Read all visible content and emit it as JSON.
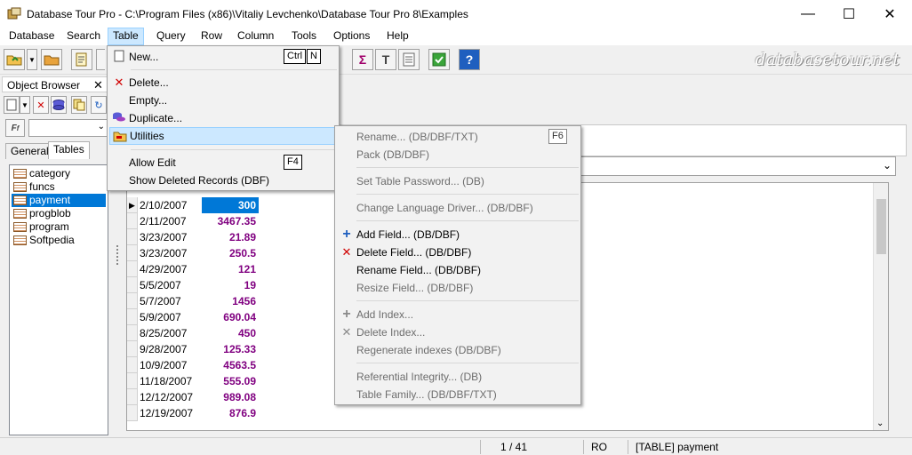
{
  "window": {
    "title": "Database Tour Pro - C:\\Program Files (x86)\\Vitaliy Levchenko\\Database Tour Pro 8\\Examples",
    "minimize_glyph": "—",
    "maximize_glyph": "☐",
    "close_glyph": "✕"
  },
  "menubar": [
    "Database",
    "Search",
    "Table",
    "Query",
    "Row",
    "Column",
    "Tools",
    "Options",
    "Help"
  ],
  "watermark": "databasetour.net",
  "toolbar": {
    "sigma_glyph": "Σ",
    "text_glyph": "T",
    "help_glyph": "?"
  },
  "object_browser": {
    "title": "Object Browser",
    "close_glyph": "✕",
    "tabs": [
      "General",
      "Tables"
    ],
    "tables": [
      "category",
      "funcs",
      "payment",
      "progblob",
      "program",
      "Softpedia"
    ],
    "selected_table": "payment"
  },
  "grid": {
    "rows": [
      {
        "date": "2/10/2007",
        "amount": "300"
      },
      {
        "date": "2/11/2007",
        "amount": "3467.35"
      },
      {
        "date": "3/23/2007",
        "amount": "21.89"
      },
      {
        "date": "3/23/2007",
        "amount": "250.5"
      },
      {
        "date": "4/29/2007",
        "amount": "121"
      },
      {
        "date": "5/5/2007",
        "amount": "19"
      },
      {
        "date": "5/7/2007",
        "amount": "1456"
      },
      {
        "date": "5/9/2007",
        "amount": "690.04"
      },
      {
        "date": "8/25/2007",
        "amount": "450"
      },
      {
        "date": "9/28/2007",
        "amount": "125.33"
      },
      {
        "date": "10/9/2007",
        "amount": "4563.5"
      },
      {
        "date": "11/18/2007",
        "amount": "555.09"
      },
      {
        "date": "12/12/2007",
        "amount": "989.08"
      },
      {
        "date": "12/19/2007",
        "amount": "876.9"
      }
    ]
  },
  "table_menu": {
    "items": [
      {
        "label": "New...",
        "shortcut": [
          "Ctrl",
          "N"
        ],
        "icon": "new-doc-icon"
      },
      {
        "label": "Delete...",
        "icon": "red-x-icon"
      },
      {
        "label": "Empty..."
      },
      {
        "label": "Duplicate...",
        "icon": "duplicate-icon"
      },
      {
        "label": "Utilities",
        "icon": "folder-icon",
        "highlighted": true
      },
      {
        "label": "Allow Edit",
        "shortcut": [
          "F4"
        ]
      },
      {
        "label": "Show Deleted Records (DBF)"
      }
    ]
  },
  "utilities_menu": {
    "items": [
      {
        "label": "Rename... (DB/DBF/TXT)",
        "shortcut": "F6",
        "disabled": true
      },
      {
        "label": "Pack (DB/DBF)",
        "disabled": true
      },
      {
        "label": "Set Table Password... (DB)",
        "disabled": true
      },
      {
        "label": "Change Language Driver... (DB/DBF)",
        "disabled": true
      },
      {
        "label": "Add Field... (DB/DBF)",
        "icon": "plus-icon",
        "disabled": false
      },
      {
        "label": "Delete Field... (DB/DBF)",
        "icon": "red-x-icon",
        "disabled": false
      },
      {
        "label": "Rename Field... (DB/DBF)",
        "disabled": false
      },
      {
        "label": "Resize Field... (DB/DBF)",
        "disabled": true
      },
      {
        "label": "Add Index...",
        "icon": "plus-gray-icon",
        "disabled": true
      },
      {
        "label": "Delete Index...",
        "icon": "x-gray-icon",
        "disabled": true
      },
      {
        "label": "Regenerate indexes (DB/DBF)",
        "disabled": true
      },
      {
        "label": "Referential Integrity... (DB)",
        "disabled": true
      },
      {
        "label": "Table Family... (DB/DBF/TXT)",
        "disabled": true
      }
    ]
  },
  "statusbar": {
    "position": "1 / 41",
    "mode": "RO",
    "object": "[TABLE] payment"
  },
  "colors": {
    "accent": "#0078d7",
    "menu_highlight": "#cce8ff",
    "amount_text": "#800080"
  }
}
